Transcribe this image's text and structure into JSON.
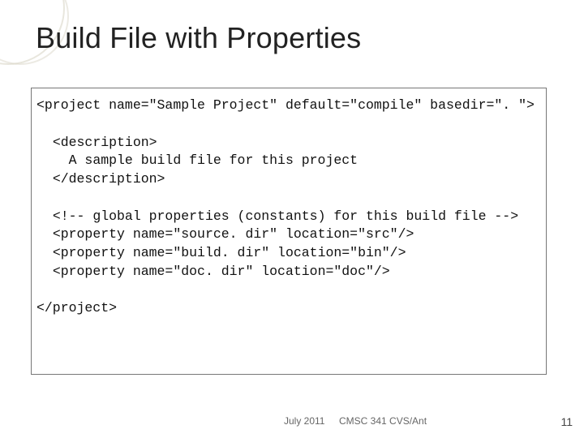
{
  "title": "Build File with Properties",
  "code": {
    "line1": "<project name=\"Sample Project\" default=\"compile\" basedir=\". \">",
    "blank1": "",
    "line2": "  <description>",
    "line3": "    A sample build file for this project",
    "line4": "  </description>",
    "blank2": "",
    "line5": "  <!-- global properties (constants) for this build file -->",
    "line6": "  <property name=\"source. dir\" location=\"src\"/>",
    "line7": "  <property name=\"build. dir\" location=\"bin\"/>",
    "line8": "  <property name=\"doc. dir\" location=\"doc\"/>",
    "blank3": "",
    "line9": "</project>"
  },
  "footer": {
    "date": "July 2011",
    "course": "CMSC 341 CVS/Ant",
    "page": "11"
  }
}
